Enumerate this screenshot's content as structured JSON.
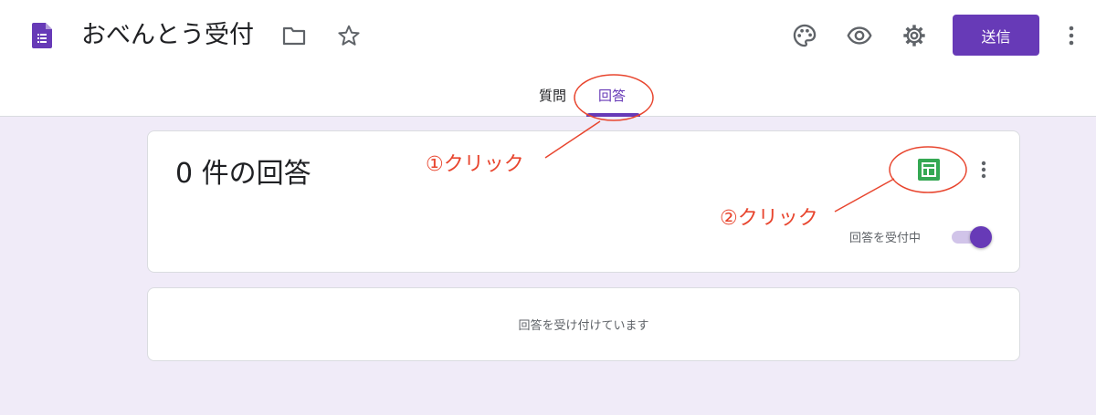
{
  "header": {
    "form_title": "おべんとう受付",
    "send_label": "送信",
    "icons": [
      "forms-app-icon",
      "folder-icon",
      "star-icon",
      "palette-icon",
      "eye-icon",
      "gear-icon",
      "more-vert-icon"
    ]
  },
  "tabs": [
    {
      "label": "質問",
      "active": false
    },
    {
      "label": "回答",
      "active": true
    }
  ],
  "summary": {
    "response_count": "0 件の回答",
    "accepting_label": "回答を受付中",
    "accepting": true
  },
  "status": {
    "message": "回答を受け付けています"
  },
  "annotations": [
    {
      "text": "①クリック"
    },
    {
      "text": "②クリック"
    }
  ],
  "colors": {
    "accent": "#673ab7",
    "background": "#f0ebf8",
    "sheets": "#34a853",
    "annotation": "#e8452e"
  }
}
